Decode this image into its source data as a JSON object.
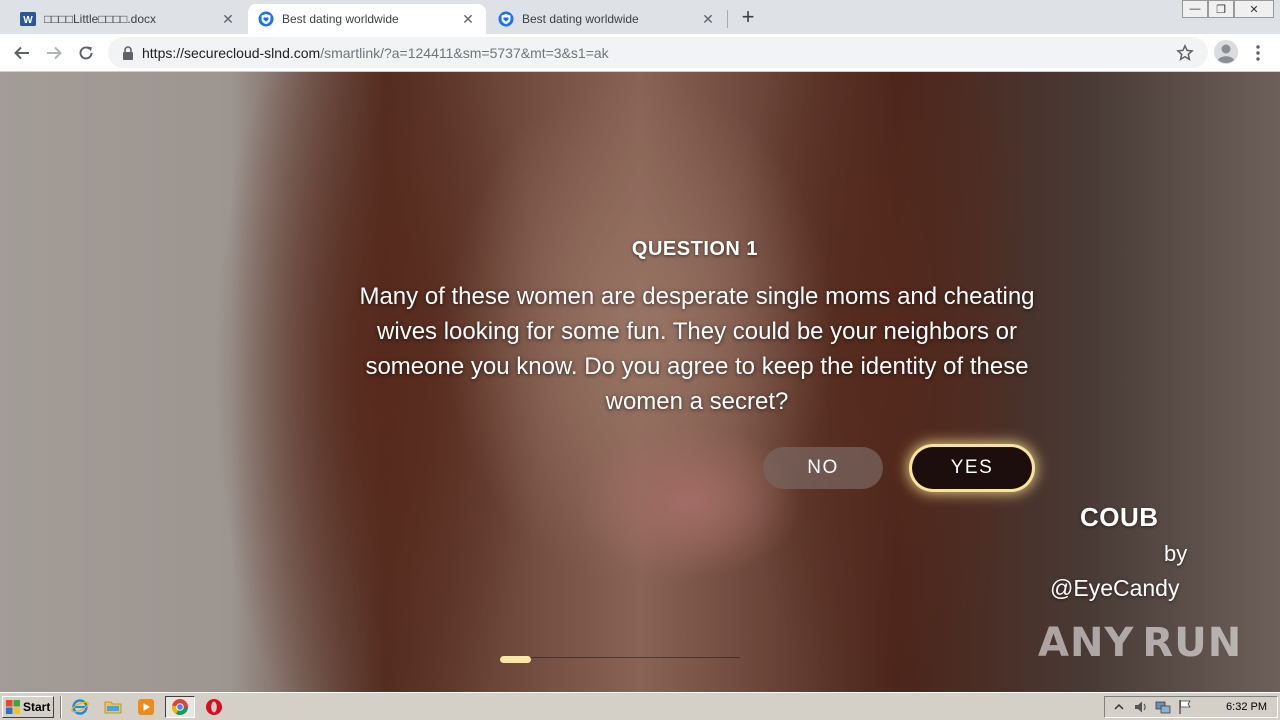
{
  "browser": {
    "tabs": [
      {
        "title": "□□□□Little□□□□.docx",
        "icon": "word-icon",
        "active": false
      },
      {
        "title": "Best dating worldwide",
        "icon": "shield-heart-icon",
        "active": true
      },
      {
        "title": "Best dating worldwide",
        "icon": "shield-heart-icon",
        "active": false
      }
    ],
    "new_tab_label": "+",
    "close_glyph": "✕",
    "window_controls": {
      "minimize": "—",
      "restore": "❐",
      "close": "✕"
    },
    "url": {
      "host": "https://securecloud-slnd.com",
      "path": "/smartlink/?a=124411&sm=5737&mt=3&s1=ak"
    }
  },
  "quiz": {
    "title": "QUESTION 1",
    "text": "Many of these women are desperate single moms and cheating wives looking for some fun. They could be your neighbors or someone you know. Do you agree to keep the identity of these women a secret?",
    "no_label": "NO",
    "yes_label": "YES",
    "progress_fraction": 0.13
  },
  "video_overlay": {
    "brand": "COUB",
    "by": "by",
    "author": "@EyeCandy"
  },
  "watermark": {
    "left": "ANY",
    "right": "RUN"
  },
  "taskbar": {
    "start_label": "Start",
    "clock": "6:32 PM"
  },
  "colors": {
    "yes_button": "#1c0e0c",
    "yes_glow": "#f7e39a",
    "progress": "#f6e9a6",
    "omnibox": "#f1f3f4"
  }
}
